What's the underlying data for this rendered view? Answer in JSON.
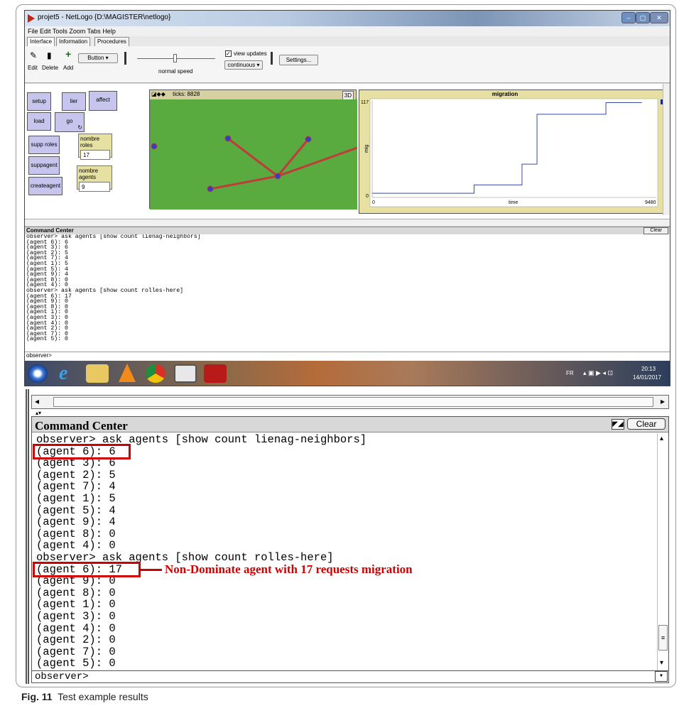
{
  "window": {
    "title": "projet5 - NetLogo {D:\\MAGISTER\\netlogo}",
    "menu": [
      "File",
      "Edit",
      "Tools",
      "Zoom",
      "Tabs",
      "Help"
    ],
    "tabs": [
      "Interface",
      "Information",
      "Procedures"
    ]
  },
  "toolbar": {
    "edit_label": "Edit",
    "delete_label": "Delete",
    "add_label": "Add",
    "widget_type": "Button",
    "speed_label": "normal speed",
    "view_updates_label": "view updates",
    "update_mode": "continuous",
    "settings_label": "Settings..."
  },
  "interface": {
    "buttons": [
      "setup",
      "lier",
      "affect",
      "load",
      "go",
      "supp roles",
      "suppagent",
      "createagent"
    ],
    "monitors": [
      {
        "label": "nombre roles",
        "value": "17"
      },
      {
        "label": "nombre agents",
        "value": "9"
      }
    ],
    "ticks_label": "ticks: 8828",
    "three_d_label": "3D"
  },
  "chart_data": {
    "type": "line",
    "title": "migration",
    "xlabel": "time",
    "ylabel": "mig",
    "xlim": [
      0,
      9480
    ],
    "ylim": [
      0,
      117
    ],
    "x_tick_labels": [
      "0",
      "9480"
    ],
    "y_tick_labels": [
      "0",
      "117"
    ],
    "legend_position": "top-right",
    "series": [
      {
        "name": "mig",
        "color": "#3a4aa0",
        "x": [
          0,
          3400,
          3400,
          5000,
          5000,
          5500,
          5500,
          7800,
          7800,
          9000
        ],
        "y": [
          5,
          5,
          15,
          15,
          40,
          40,
          100,
          100,
          114,
          114
        ]
      }
    ]
  },
  "command_center": {
    "title": "Command Center",
    "clear_label": "Clear",
    "prompt": "observer>",
    "lines": [
      "observer> ask agents [show count lienag-neighbors]",
      "(agent 6): 6",
      "(agent 3): 6",
      "(agent 2): 5",
      "(agent 7): 4",
      "(agent 1): 5",
      "(agent 5): 4",
      "(agent 9): 4",
      "(agent 8): 0",
      "(agent 4): 0",
      "observer> ask agents [show count rolles-here]",
      "(agent 6): 17",
      "(agent 9): 0",
      "(agent 8): 0",
      "(agent 1): 0",
      "(agent 3): 0",
      "(agent 4): 0",
      "(agent 2): 0",
      "(agent 7): 0",
      "(agent 5): 0"
    ]
  },
  "taskbar": {
    "lang": "FR",
    "time": "20:13",
    "date": "14/01/2017"
  },
  "annotation": "Non-Dominate agent with 17 requests migration",
  "caption": {
    "label": "Fig. 11",
    "text": "Test example results"
  }
}
